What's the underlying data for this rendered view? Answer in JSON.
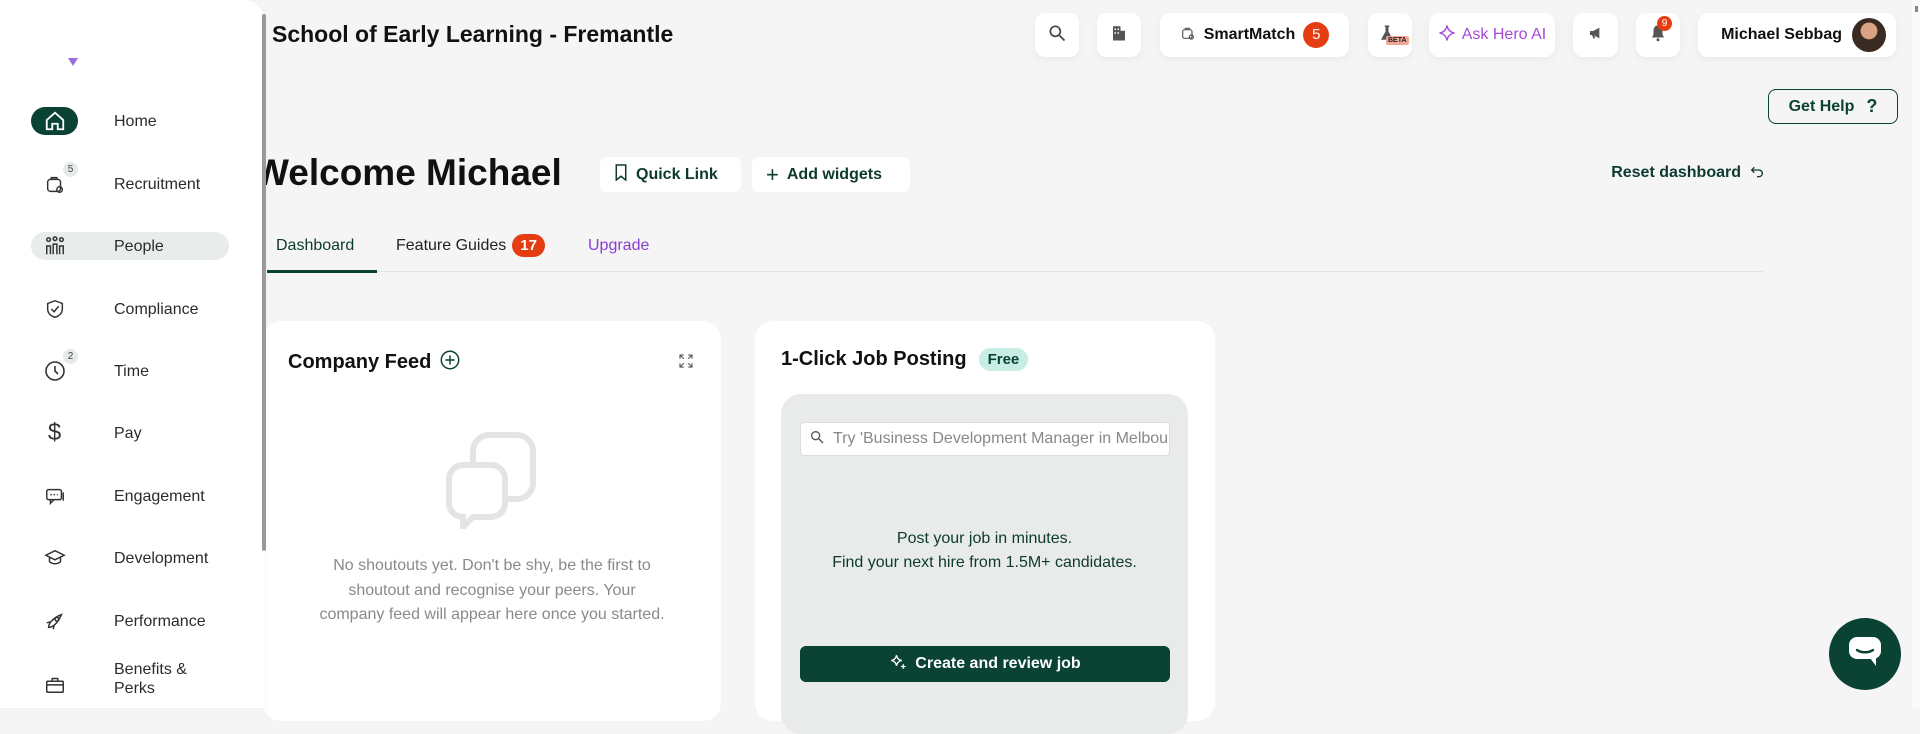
{
  "header": {
    "org_title": "School of Early Learning - Fremantle",
    "smartmatch_label": "SmartMatch",
    "smartmatch_count": "5",
    "beta_label": "BETA",
    "ask_ai_label": "Ask Hero AI",
    "notification_count": "9",
    "user_name": "Michael Sebbag",
    "get_help_label": "Get Help",
    "get_help_icon": "?"
  },
  "sidebar": {
    "items": [
      {
        "label": "Home",
        "icon": "home-icon"
      },
      {
        "label": "Recruitment",
        "icon": "briefcase-search-icon",
        "count": "5"
      },
      {
        "label": "People",
        "icon": "people-icon"
      },
      {
        "label": "Compliance",
        "icon": "shield-check-icon"
      },
      {
        "label": "Time",
        "icon": "clock-icon",
        "count": "2"
      },
      {
        "label": "Pay",
        "icon": "dollar-icon"
      },
      {
        "label": "Engagement",
        "icon": "chat-icon"
      },
      {
        "label": "Development",
        "icon": "graduation-cap-icon"
      },
      {
        "label": "Performance",
        "icon": "rocket-icon"
      },
      {
        "label": "Benefits & Perks",
        "icon": "gift-icon"
      }
    ]
  },
  "main": {
    "welcome": "Welcome Michael",
    "quick_link_label": "Quick Link",
    "add_widgets_label": "Add widgets",
    "reset_label": "Reset dashboard",
    "tabs": [
      {
        "label": "Dashboard"
      },
      {
        "label": "Feature Guides",
        "badge": "17"
      },
      {
        "label": "Upgrade"
      }
    ],
    "feed": {
      "title": "Company Feed",
      "empty_text": "No shoutouts yet. Don't be shy, be the first to shoutout and recognise your peers. Your company feed will appear here once you started."
    },
    "job": {
      "title": "1-Click Job Posting",
      "badge": "Free",
      "search_placeholder": "Try 'Business Development Manager in Melbourne'",
      "line1": "Post your job in minutes.",
      "line2": "Find your next hire from 1.5M+ candidates.",
      "button_label": "Create and review job"
    }
  },
  "colors": {
    "brand": "#0a4234",
    "badge": "#e43d12",
    "purple": "#8a3ed1"
  }
}
